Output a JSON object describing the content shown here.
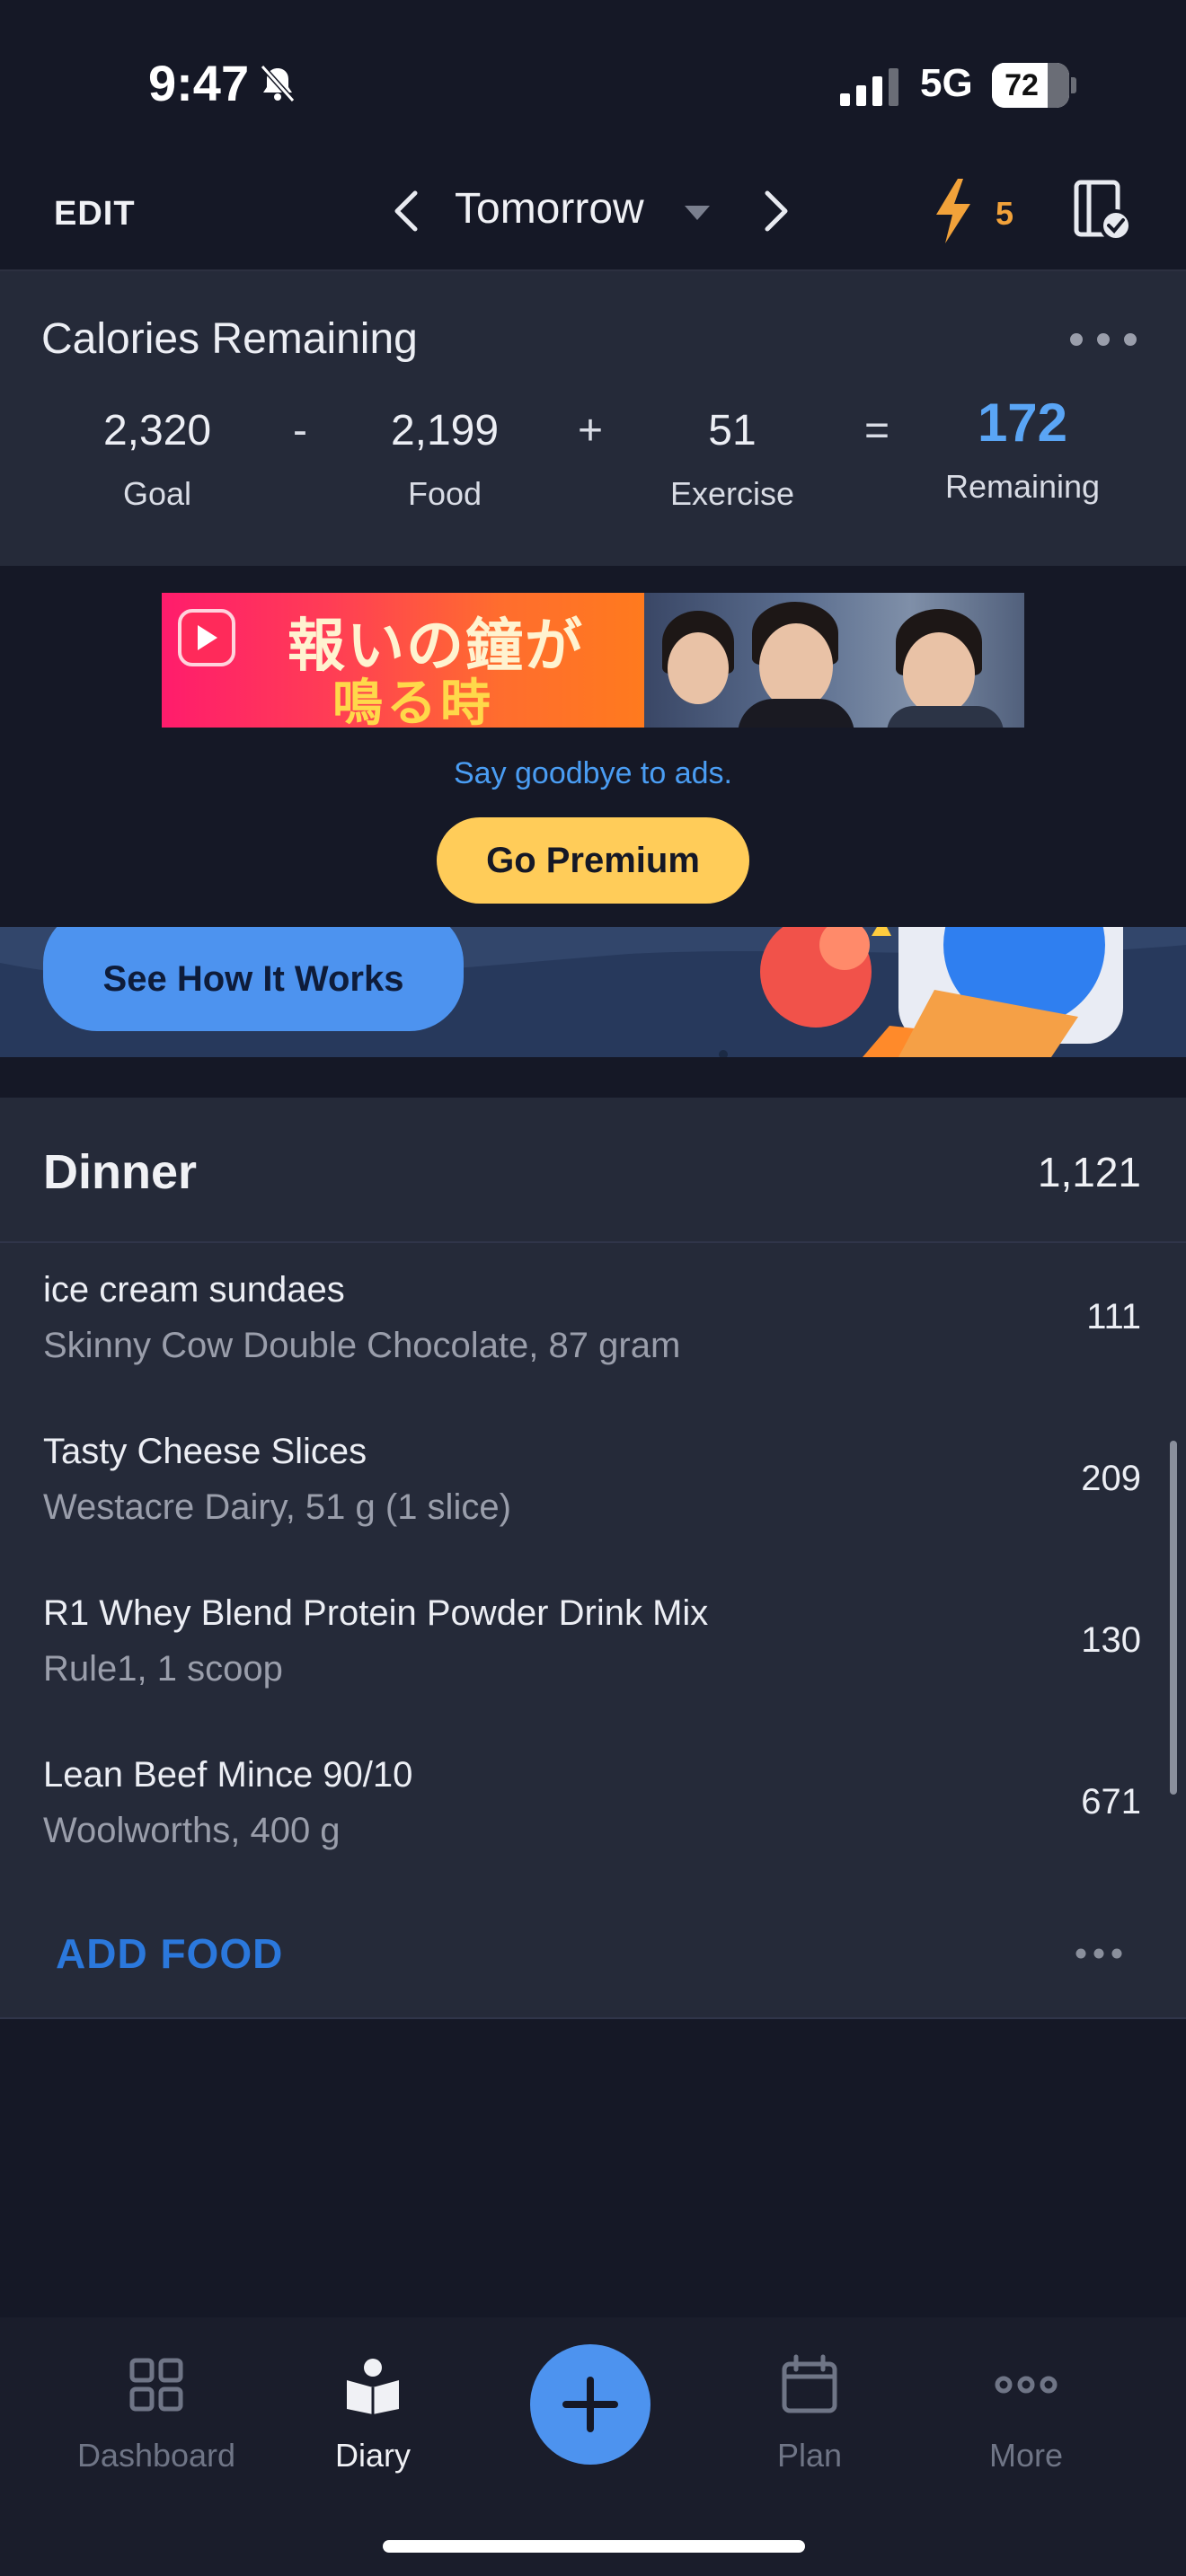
{
  "status_bar": {
    "time": "9:47",
    "network": "5G",
    "battery": "72"
  },
  "header": {
    "edit_label": "EDIT",
    "day_label": "Tomorrow",
    "streak_count": "5"
  },
  "calories": {
    "title": "Calories Remaining",
    "goal_value": "2,320",
    "goal_label": "Goal",
    "minus": "-",
    "food_value": "2,199",
    "food_label": "Food",
    "plus": "+",
    "exercise_value": "51",
    "exercise_label": "Exercise",
    "equals": "=",
    "remaining_value": "172",
    "remaining_label": "Remaining"
  },
  "ad": {
    "banner_line1": "報いの鐘が",
    "banner_line2": "鳴る時",
    "goodbye_text": "Say goodbye to ads.",
    "premium_label": "Go Premium"
  },
  "promo": {
    "button_label": "See How It Works"
  },
  "dinner": {
    "title": "Dinner",
    "total": "1,121",
    "items": [
      {
        "name": "ice cream sundaes",
        "desc": "Skinny Cow Double Chocolate, 87 gram",
        "calories": "111"
      },
      {
        "name": "Tasty Cheese Slices",
        "desc": "Westacre Dairy, 51 g (1 slice)",
        "calories": "209"
      },
      {
        "name": "R1 Whey Blend Protein Powder Drink Mix",
        "desc": "Rule1, 1 scoop",
        "calories": "130"
      },
      {
        "name": "Lean Beef Mince 90/10",
        "desc": "Woolworths, 400 g",
        "calories": "671"
      }
    ],
    "add_food_label": "ADD FOOD"
  },
  "tabs": [
    {
      "label": "Dashboard",
      "icon": "dashboard-icon"
    },
    {
      "label": "Diary",
      "icon": "diary-icon",
      "active": true
    },
    {
      "label": "Plan",
      "icon": "calendar-icon"
    },
    {
      "label": "More",
      "icon": "more-icon"
    }
  ],
  "colors": {
    "background": "#151826",
    "card": "#252a39",
    "accent_blue": "#4d93ef",
    "remaining_blue": "#5aa5f5",
    "premium_yellow": "#ffcc59",
    "streak_orange": "#f2a23a"
  }
}
